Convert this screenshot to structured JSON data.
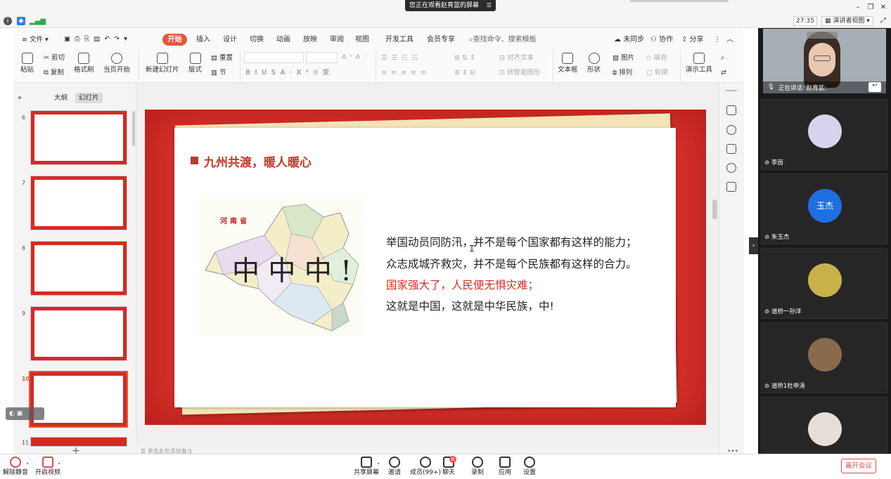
{
  "meeting": {
    "banner": "您正在观看赵育蓝的屏幕",
    "timer": "27:35",
    "view_mode": "演讲者视图",
    "colors": {
      "accent": "#e35a3b",
      "leave": "#e04b4b"
    }
  },
  "ribbon": {
    "file_label": "文件",
    "tabs": [
      "开始",
      "插入",
      "设计",
      "切换",
      "动画",
      "放映",
      "审阅",
      "视图",
      "开发工具",
      "会员专享"
    ],
    "search_placeholder": "查找命令、搜索模板",
    "sync_label": "未同步",
    "collab_label": "协作",
    "share_label": "分享",
    "paste_label": "粘贴",
    "cut_label": "剪切",
    "copy_label": "复制",
    "format_painter_label": "格式刷",
    "play_current_label": "当页开始",
    "new_slide_label": "新建幻灯片",
    "layout_label": "版式",
    "section_label": "节",
    "reset_label": "重置",
    "align_text_label": "对齐文本",
    "smart_graphic_label": "转智能图形",
    "textbox_label": "文本框",
    "shape_label": "形状",
    "picture_label": "图片",
    "fill_label": "填充",
    "arrange_label": "排列",
    "outline_label": "轮廓",
    "present_tools_label": "演示工具"
  },
  "left_panel": {
    "tabs": [
      "大纲",
      "幻灯片"
    ],
    "slide_numbers": [
      "6",
      "7",
      "8",
      "9",
      "10",
      "11"
    ],
    "selected_slide": "10"
  },
  "slide": {
    "title": "九州共渡，暖人暖心",
    "map_label": "河南省",
    "map_overlay": "中 中 中 !",
    "lines": [
      {
        "text": "举国动员同防汛，并不是每个国家都有这样的能力；",
        "color": "#222222"
      },
      {
        "text": "众志成城齐救灾，并不是每个民族都有这样的合力。",
        "color": "#222222"
      },
      {
        "text": "国家强大了，人民便无惧灾难；",
        "color": "#d62b22"
      },
      {
        "text": "这就是中国，这就是中华民族，中!",
        "color": "#222222"
      }
    ],
    "notes_hint": "单击此处添加备注"
  },
  "participants": {
    "speaker_label": "正在讲话: 赵育蓝;",
    "list": [
      {
        "name": "李茵"
      },
      {
        "name": "朱玉杰",
        "avatar_text": "玉杰",
        "avatar_color": "#1f6fe0"
      },
      {
        "name": "道桥一孙洋"
      },
      {
        "name": "道桥1杜申涛"
      },
      {
        "name": ""
      }
    ]
  },
  "bottom": {
    "unmute": "解除静音",
    "video": "开启视频",
    "share": "共享屏幕",
    "invite": "邀请",
    "members": "成员(99+)",
    "chat": "聊天",
    "chat_badge": "8",
    "record": "录制",
    "apps": "应用",
    "settings": "设置",
    "leave": "离开会议"
  }
}
